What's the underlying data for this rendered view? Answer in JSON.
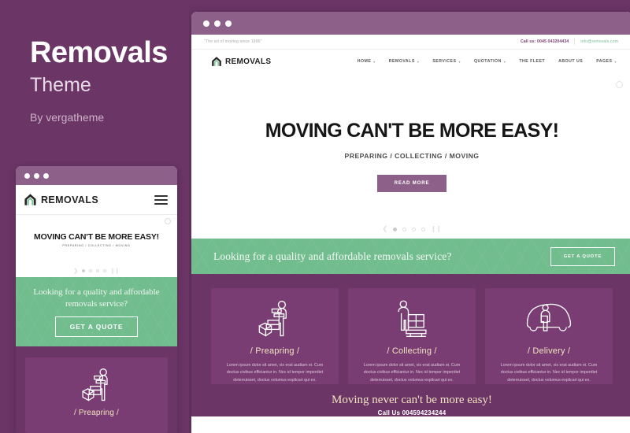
{
  "colors": {
    "purple_bg": "#6b3566",
    "purple_card": "#793d73",
    "chrome_purple": "#8d6089",
    "green": "#72bd8e",
    "cream": "#f2e4c0",
    "accent_button": "#8d6089"
  },
  "promo": {
    "title": "Removals",
    "subtitle": "Theme",
    "author": "By vergatheme"
  },
  "site": {
    "topbar": {
      "tagline": "\"The art of moving since 1996\"",
      "phone": "Call us: 0045 043204434",
      "email": "info@removals.com"
    },
    "brand": {
      "name": "REMOVALS",
      "logo_icon": "house-arch-icon"
    },
    "menu": [
      {
        "label": "HOME",
        "has_dropdown": true
      },
      {
        "label": "REMOVALS",
        "has_dropdown": true
      },
      {
        "label": "SERVICES",
        "has_dropdown": true
      },
      {
        "label": "QUOTATION",
        "has_dropdown": true
      },
      {
        "label": "THE FLEET",
        "has_dropdown": false
      },
      {
        "label": "ABOUT US",
        "has_dropdown": false
      },
      {
        "label": "PAGES",
        "has_dropdown": true
      }
    ],
    "hero": {
      "title": "MOVING CAN'T BE MORE EASY!",
      "subtitle": "PREPARING / COLLECTING / MOVING",
      "button": "READ MORE",
      "slider": {
        "prev_icon": "chevron-left-icon",
        "next_icon": "chevron-right-icon",
        "dots": 4,
        "active_dot": 1,
        "pause_icon": "pause-icon"
      }
    },
    "cta": {
      "text": "Looking for a quality and affordable removals service?",
      "button": "GET A QUOTE"
    },
    "services": [
      {
        "title": "/ Preapring /",
        "icon": "packing-boxes-worker-icon",
        "body": "Lorem ipsum dolor sit amet, vix erat audiam ei. Cum doctus civibus efficiantur in. Nec id tempor imperdiet deterruisset, doctus volumus explicari qui ex."
      },
      {
        "title": "/ Collecting /",
        "icon": "worker-pallet-icon",
        "body": "Lorem ipsum dolor sit amet, vix erat audiam ei. Cum doctus civibus efficiantur in. Nec id tempor imperdiet deterruisset, doctus volumus explicari qui ex."
      },
      {
        "title": "/ Delivery /",
        "icon": "delivery-van-worker-icon",
        "body": "Lorem ipsum dolor sit amet, vix erat audiam ei. Cum doctus civibus efficiantur in. Nec id tempor imperdiet deterruisset, doctus volumus explicari qui ex."
      }
    ],
    "footer": {
      "title": "Moving never can't be more easy!",
      "call": "Call Us 004594234244"
    }
  },
  "mobile": {
    "brand": "REMOVALS",
    "menu_icon": "hamburger-icon",
    "hero_title": "MOVING CAN'T BE MORE EASY!",
    "hero_sub": "PREPARING / COLLECTING / MOVING",
    "cta_text": "Looking for a quality and affordable removals service?",
    "cta_button": "GET A QUOTE",
    "card_title": "/ Preapring /"
  }
}
